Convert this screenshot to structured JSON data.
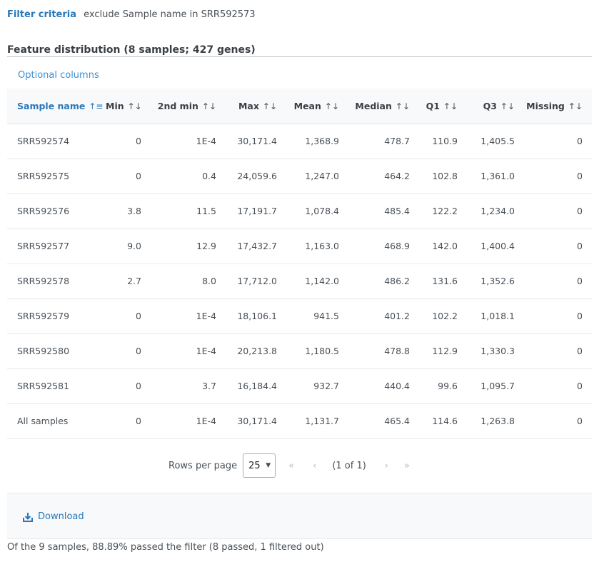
{
  "filter": {
    "label": "Filter criteria",
    "text": "exclude Sample name in SRR592573"
  },
  "section_title": "Feature distribution (8 samples; 427 genes)",
  "optional_columns_label": "Optional columns",
  "table": {
    "columns": [
      "Sample name",
      "Min",
      "2nd min",
      "Max",
      "Mean",
      "Median",
      "Q1",
      "Q3",
      "Missing"
    ],
    "rows": [
      [
        "SRR592574",
        "0",
        "1E-4",
        "30,171.4",
        "1,368.9",
        "478.7",
        "110.9",
        "1,405.5",
        "0"
      ],
      [
        "SRR592575",
        "0",
        "0.4",
        "24,059.6",
        "1,247.0",
        "464.2",
        "102.8",
        "1,361.0",
        "0"
      ],
      [
        "SRR592576",
        "3.8",
        "11.5",
        "17,191.7",
        "1,078.4",
        "485.4",
        "122.2",
        "1,234.0",
        "0"
      ],
      [
        "SRR592577",
        "9.0",
        "12.9",
        "17,432.7",
        "1,163.0",
        "468.9",
        "142.0",
        "1,400.4",
        "0"
      ],
      [
        "SRR592578",
        "2.7",
        "8.0",
        "17,712.0",
        "1,142.0",
        "486.2",
        "131.6",
        "1,352.6",
        "0"
      ],
      [
        "SRR592579",
        "0",
        "1E-4",
        "18,106.1",
        "941.5",
        "401.2",
        "102.2",
        "1,018.1",
        "0"
      ],
      [
        "SRR592580",
        "0",
        "1E-4",
        "20,213.8",
        "1,180.5",
        "478.8",
        "112.9",
        "1,330.3",
        "0"
      ],
      [
        "SRR592581",
        "0",
        "3.7",
        "16,184.4",
        "932.7",
        "440.4",
        "99.6",
        "1,095.7",
        "0"
      ],
      [
        "All samples",
        "0",
        "1E-4",
        "30,171.4",
        "1,131.7",
        "465.4",
        "114.6",
        "1,263.8",
        "0"
      ]
    ]
  },
  "pagination": {
    "rows_per_page_label": "Rows per page",
    "rows_per_page_value": "25",
    "page_info": "(1 of 1)",
    "first_icon": "«",
    "prev_icon": "‹",
    "next_icon": "›",
    "last_icon": "»"
  },
  "download_label": "Download",
  "summary": "Of the 9 samples, 88.89% passed the filter (8 passed, 1 filtered out)",
  "colors": {
    "accent": "#2a78b8",
    "link": "#3d8fd6",
    "header_bg": "#f8f9fa"
  },
  "icons": {
    "sort": "sort-icon",
    "sort_active": "sort-ascending-icon",
    "download": "download-icon",
    "caret": "caret-down-icon"
  }
}
